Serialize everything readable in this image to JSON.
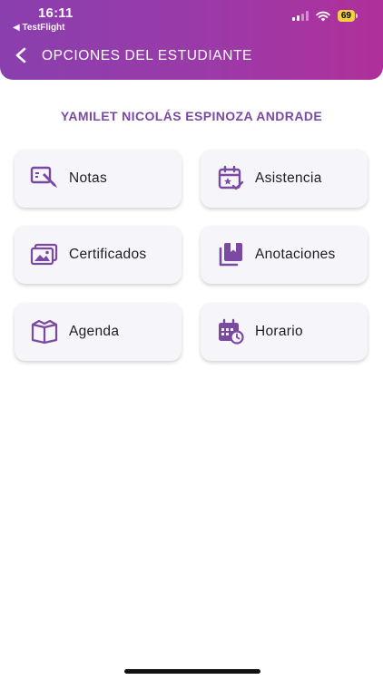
{
  "status_bar": {
    "time": "16:11",
    "back_app": "◀ TestFlight",
    "battery": "69"
  },
  "header": {
    "title": "OPCIONES DEL ESTUDIANTE"
  },
  "student": {
    "name": "YAMILET NICOLÁS ESPINOZA ANDRADE"
  },
  "options": [
    {
      "label": "Notas",
      "icon": "grades-icon"
    },
    {
      "label": "Asistencia",
      "icon": "attendance-calendar-icon"
    },
    {
      "label": "Certificados",
      "icon": "certificates-icon"
    },
    {
      "label": "Anotaciones",
      "icon": "annotations-icon"
    },
    {
      "label": "Agenda",
      "icon": "agenda-book-icon"
    },
    {
      "label": "Horario",
      "icon": "schedule-calendar-icon"
    }
  ],
  "colors": {
    "header_gradient_start": "#8a3fae",
    "header_gradient_end": "#b0309a",
    "accent": "#7a4aa3",
    "card_bg": "#f6f5fa",
    "battery": "#f5d142"
  }
}
